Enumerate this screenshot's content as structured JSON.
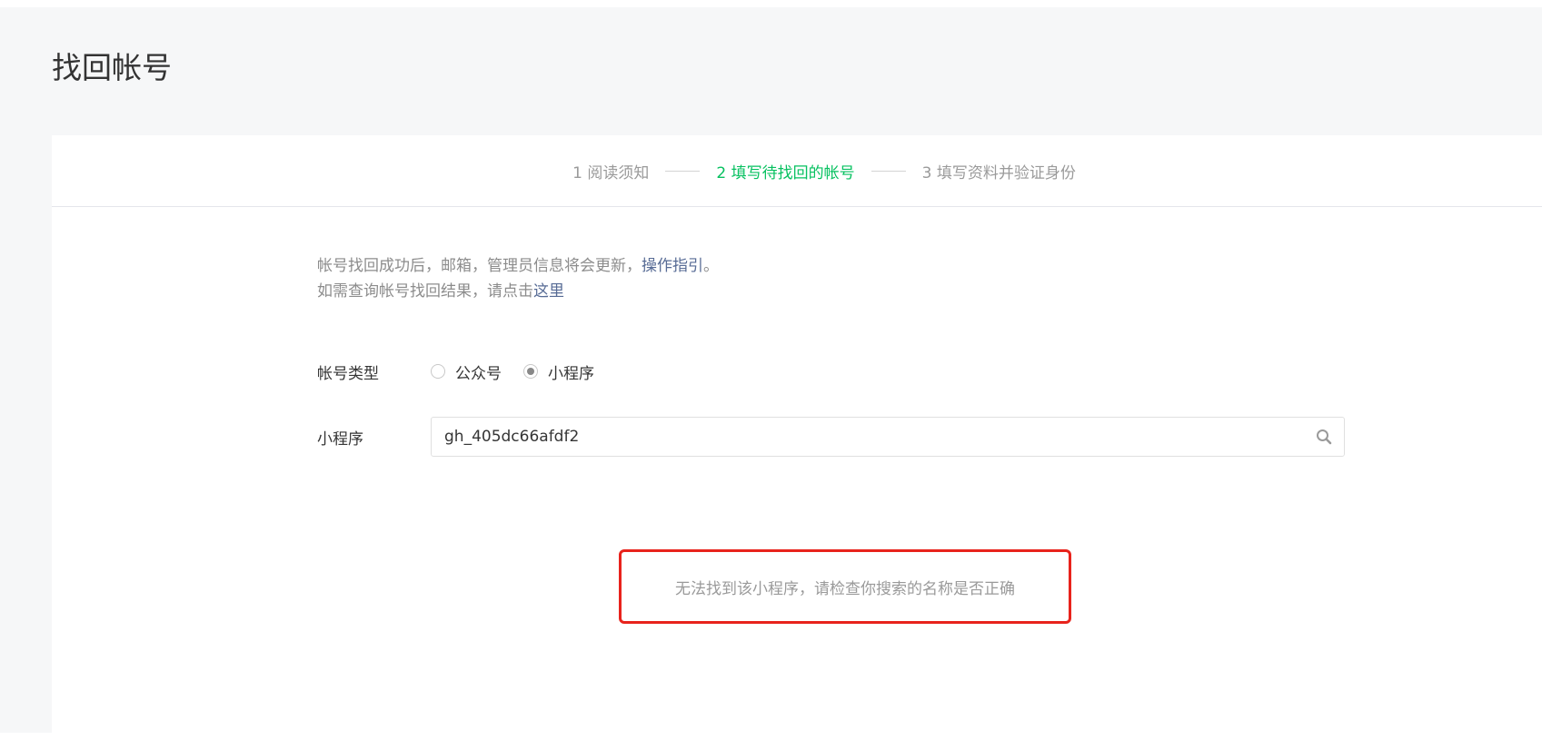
{
  "page": {
    "title": "找回帐号"
  },
  "steps": [
    {
      "label": "1 阅读须知",
      "active": false
    },
    {
      "label": "2 填写待找回的帐号",
      "active": true
    },
    {
      "label": "3 填写资料并验证身份",
      "active": false
    }
  ],
  "notice": {
    "line1_text": "帐号找回成功后，邮箱，管理员信息将会更新，",
    "line1_link": "操作指引",
    "line1_end": "。",
    "line2_text": "如需查询帐号找回结果，请点击",
    "line2_link": "这里"
  },
  "form": {
    "account_type_label": "帐号类型",
    "options": [
      {
        "label": "公众号",
        "checked": false
      },
      {
        "label": "小程序",
        "checked": true
      }
    ],
    "app_label": "小程序",
    "app_value": "gh_405dc66afdf2"
  },
  "error": {
    "message": "无法找到该小程序，请检查你搜索的名称是否正确"
  },
  "colors": {
    "accent_green": "#07c160",
    "link": "#576b95",
    "error_border": "#e8231c"
  },
  "icons": {
    "search": "search-icon"
  }
}
